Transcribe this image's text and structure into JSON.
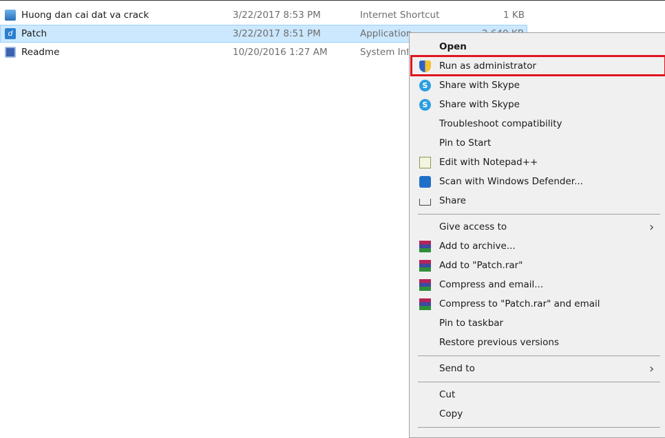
{
  "files": [
    {
      "name": "Huong dan cai dat va crack",
      "date": "3/22/2017 8:53 PM",
      "type": "Internet Shortcut",
      "size": "1 KB",
      "icon": "internet-shortcut-icon"
    },
    {
      "name": "Patch",
      "date": "3/22/2017 8:51 PM",
      "type": "Application",
      "size": "2,640 KB",
      "icon": "application-icon",
      "selected": true
    },
    {
      "name": "Readme",
      "date": "10/20/2016 1:27 AM",
      "type": "System Information File",
      "size": "",
      "icon": "system-info-icon"
    }
  ],
  "menu": {
    "open": "Open",
    "run_admin": "Run as administrator",
    "skype1": "Share with Skype",
    "skype2": "Share with Skype",
    "troubleshoot": "Troubleshoot compatibility",
    "pin_start": "Pin to Start",
    "notepad": "Edit with Notepad++",
    "defender": "Scan with Windows Defender...",
    "share": "Share",
    "give_access": "Give access to",
    "add_archive": "Add to archive...",
    "add_rar": "Add to \"Patch.rar\"",
    "compress_email": "Compress and email...",
    "compress_rar_email": "Compress to \"Patch.rar\" and email",
    "pin_taskbar": "Pin to taskbar",
    "restore": "Restore previous versions",
    "send_to": "Send to",
    "cut": "Cut",
    "copy": "Copy"
  },
  "highlight_color": "#e0141e"
}
